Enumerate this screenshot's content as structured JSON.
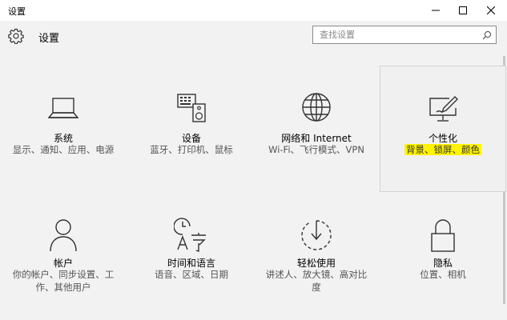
{
  "window": {
    "title": "设置"
  },
  "header": {
    "title": "设置"
  },
  "search": {
    "placeholder": "查找设置"
  },
  "colors": {
    "highlight": "#fff400",
    "background": "#f2f2f2"
  },
  "tiles": [
    {
      "name": "系统",
      "desc": "显示、通知、应用、电源",
      "icon": "laptop-icon"
    },
    {
      "name": "设备",
      "desc": "蓝牙、打印机、鼠标",
      "icon": "keyboard-speaker-icon"
    },
    {
      "name": "网络和 Internet",
      "desc": "Wi-Fi、飞行模式、VPN",
      "icon": "globe-icon"
    },
    {
      "name": "个性化",
      "desc": "背景、锁屏、颜色",
      "icon": "paint-monitor-icon"
    },
    {
      "name": "帐户",
      "desc": "你的帐户、同步设置、工作、其他用户",
      "icon": "person-icon"
    },
    {
      "name": "时间和语言",
      "desc": "语音、区域、日期",
      "icon": "time-language-icon"
    },
    {
      "name": "轻松使用",
      "desc": "讲述人、放大镜、高对比度",
      "icon": "ease-of-access-icon"
    },
    {
      "name": "隐私",
      "desc": "位置、相机",
      "icon": "lock-icon"
    }
  ]
}
